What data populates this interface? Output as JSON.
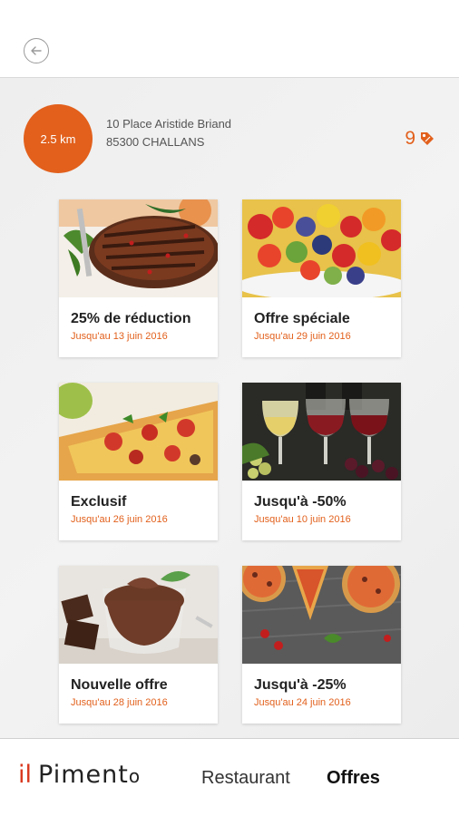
{
  "header": {
    "back_icon": "arrow-left-icon"
  },
  "store": {
    "distance": "2.5 km",
    "address_line1": "10 Place Aristide Briand",
    "address_line2": "85300 CHALLANS",
    "offer_count": "9",
    "offer_icon": "tag-icon"
  },
  "offers": [
    {
      "title": "25% de réduction",
      "date": "Jusqu'au 13 juin 2016",
      "image": "steak"
    },
    {
      "title": "Offre spéciale",
      "date": "Jusqu'au 29 juin 2016",
      "image": "fruit-salad"
    },
    {
      "title": "Exclusif",
      "date": "Jusqu'au 26 juin 2016",
      "image": "pizza-slice"
    },
    {
      "title": "Jusqu'à -50%",
      "date": "Jusqu'au 10 juin 2016",
      "image": "wine-glasses"
    },
    {
      "title": "Nouvelle offre",
      "date": "Jusqu'au 28 juin 2016",
      "image": "chocolate-mousse"
    },
    {
      "title": "Jusqu'à -25%",
      "date": "Jusqu'au 24 juin 2016",
      "image": "pizzas"
    }
  ],
  "bottom_nav": {
    "logo_prefix": "il",
    "logo_main": "Piment",
    "logo_suffix": "o",
    "items": [
      {
        "label": "Restaurant",
        "active": false
      },
      {
        "label": "Offres",
        "active": true
      }
    ]
  },
  "colors": {
    "accent": "#e2601c",
    "logo_red": "#d9381e"
  }
}
